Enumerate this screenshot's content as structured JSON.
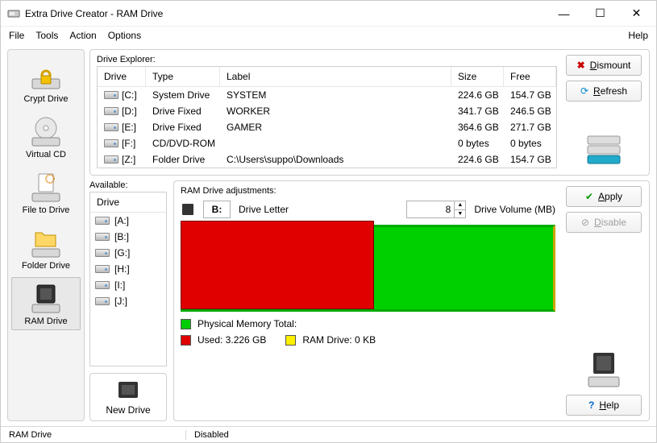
{
  "window": {
    "title": "Extra Drive Creator - RAM Drive"
  },
  "menu": {
    "file": "File",
    "tools": "Tools",
    "action": "Action",
    "options": "Options",
    "help": "Help"
  },
  "sidebar": {
    "items": [
      {
        "label": "Crypt Drive"
      },
      {
        "label": "Virtual CD"
      },
      {
        "label": "File to Drive"
      },
      {
        "label": "Folder Drive"
      },
      {
        "label": "RAM Drive"
      }
    ]
  },
  "driveExplorer": {
    "label": "Drive Explorer:",
    "columns": {
      "drive": "Drive",
      "type": "Type",
      "label": "Label",
      "size": "Size",
      "free": "Free"
    },
    "rows": [
      {
        "drive": "[C:]",
        "type": "System Drive",
        "label": "SYSTEM",
        "size": "224.6 GB",
        "free": "154.7 GB"
      },
      {
        "drive": "[D:]",
        "type": "Drive Fixed",
        "label": "WORKER",
        "size": "341.7 GB",
        "free": "246.5 GB"
      },
      {
        "drive": "[E:]",
        "type": "Drive Fixed",
        "label": "GAMER",
        "size": "364.6 GB",
        "free": "271.7 GB"
      },
      {
        "drive": "[F:]",
        "type": "CD/DVD-ROM",
        "label": "",
        "size": "0 bytes",
        "free": "0 bytes"
      },
      {
        "drive": "[Z:]",
        "type": "Folder Drive",
        "label": "C:\\Users\\suppo\\Downloads",
        "size": "224.6 GB",
        "free": "154.7 GB"
      }
    ]
  },
  "buttons": {
    "dismount": "Dismount",
    "refresh": "Refresh",
    "apply": "Apply",
    "disable": "Disable",
    "help": "Help",
    "newDrive": "New Drive"
  },
  "available": {
    "label": "Available:",
    "column": "Drive",
    "items": [
      "[A:]",
      "[B:]",
      "[G:]",
      "[H:]",
      "[I:]",
      "[J:]"
    ]
  },
  "ramAdjust": {
    "label": "RAM Drive adjustments:",
    "driveLetter": {
      "value": "B:",
      "label": "Drive Letter"
    },
    "volume": {
      "value": "8",
      "label": "Drive Volume (MB)"
    },
    "physicalTotal": "Physical Memory Total:",
    "used": "Used: 3.226 GB",
    "ramDrive": "RAM Drive: 0 KB"
  },
  "status": {
    "left": "RAM Drive",
    "right": "Disabled"
  }
}
